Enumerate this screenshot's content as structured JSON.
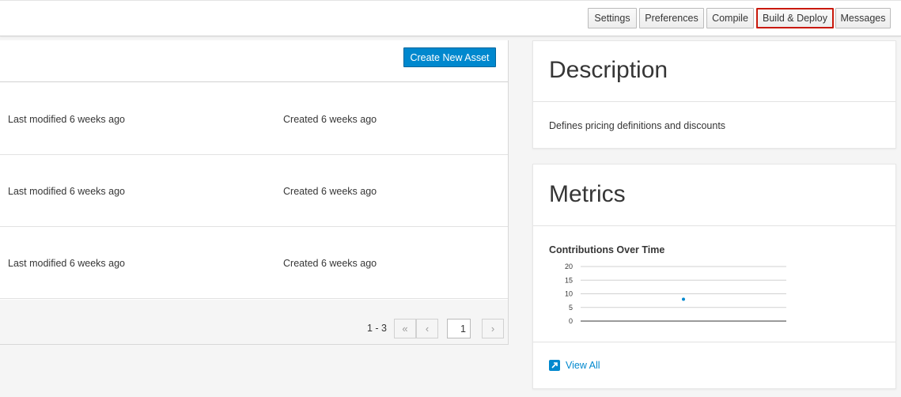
{
  "toolbar": {
    "buttons": [
      "Settings",
      "Preferences",
      "Compile",
      "Build & Deploy",
      "Messages"
    ],
    "active": "Build & Deploy",
    "active_color": "#c9190b"
  },
  "list": {
    "create_label": "Create New Asset",
    "rows": [
      {
        "modified": "Last modified 6 weeks ago",
        "created": "Created 6 weeks ago"
      },
      {
        "modified": "Last modified 6 weeks ago",
        "created": "Created 6 weeks ago"
      },
      {
        "modified": "Last modified 6 weeks ago",
        "created": "Created 6 weeks ago"
      }
    ],
    "pagination": {
      "range": "1 - 3",
      "current_page": "1",
      "first_icon": "double-chevron-left-icon",
      "prev_icon": "chevron-left-icon",
      "next_icon": "chevron-right-icon"
    }
  },
  "description": {
    "title": "Description",
    "text": "Defines pricing definitions and discounts"
  },
  "metrics": {
    "title": "Metrics",
    "view_all": "View All",
    "link_icon": "external-link-icon",
    "accent": "#0088ce"
  },
  "chart_data": {
    "type": "scatter",
    "title": "Contributions Over Time",
    "xlabel": "",
    "ylabel": "",
    "ylim": [
      0,
      20
    ],
    "yticks": [
      0,
      5,
      10,
      15,
      20
    ],
    "grid": true,
    "series": [
      {
        "values": [
          8
        ]
      }
    ],
    "point_x_fraction": [
      0.5
    ],
    "color": "#0088ce"
  }
}
